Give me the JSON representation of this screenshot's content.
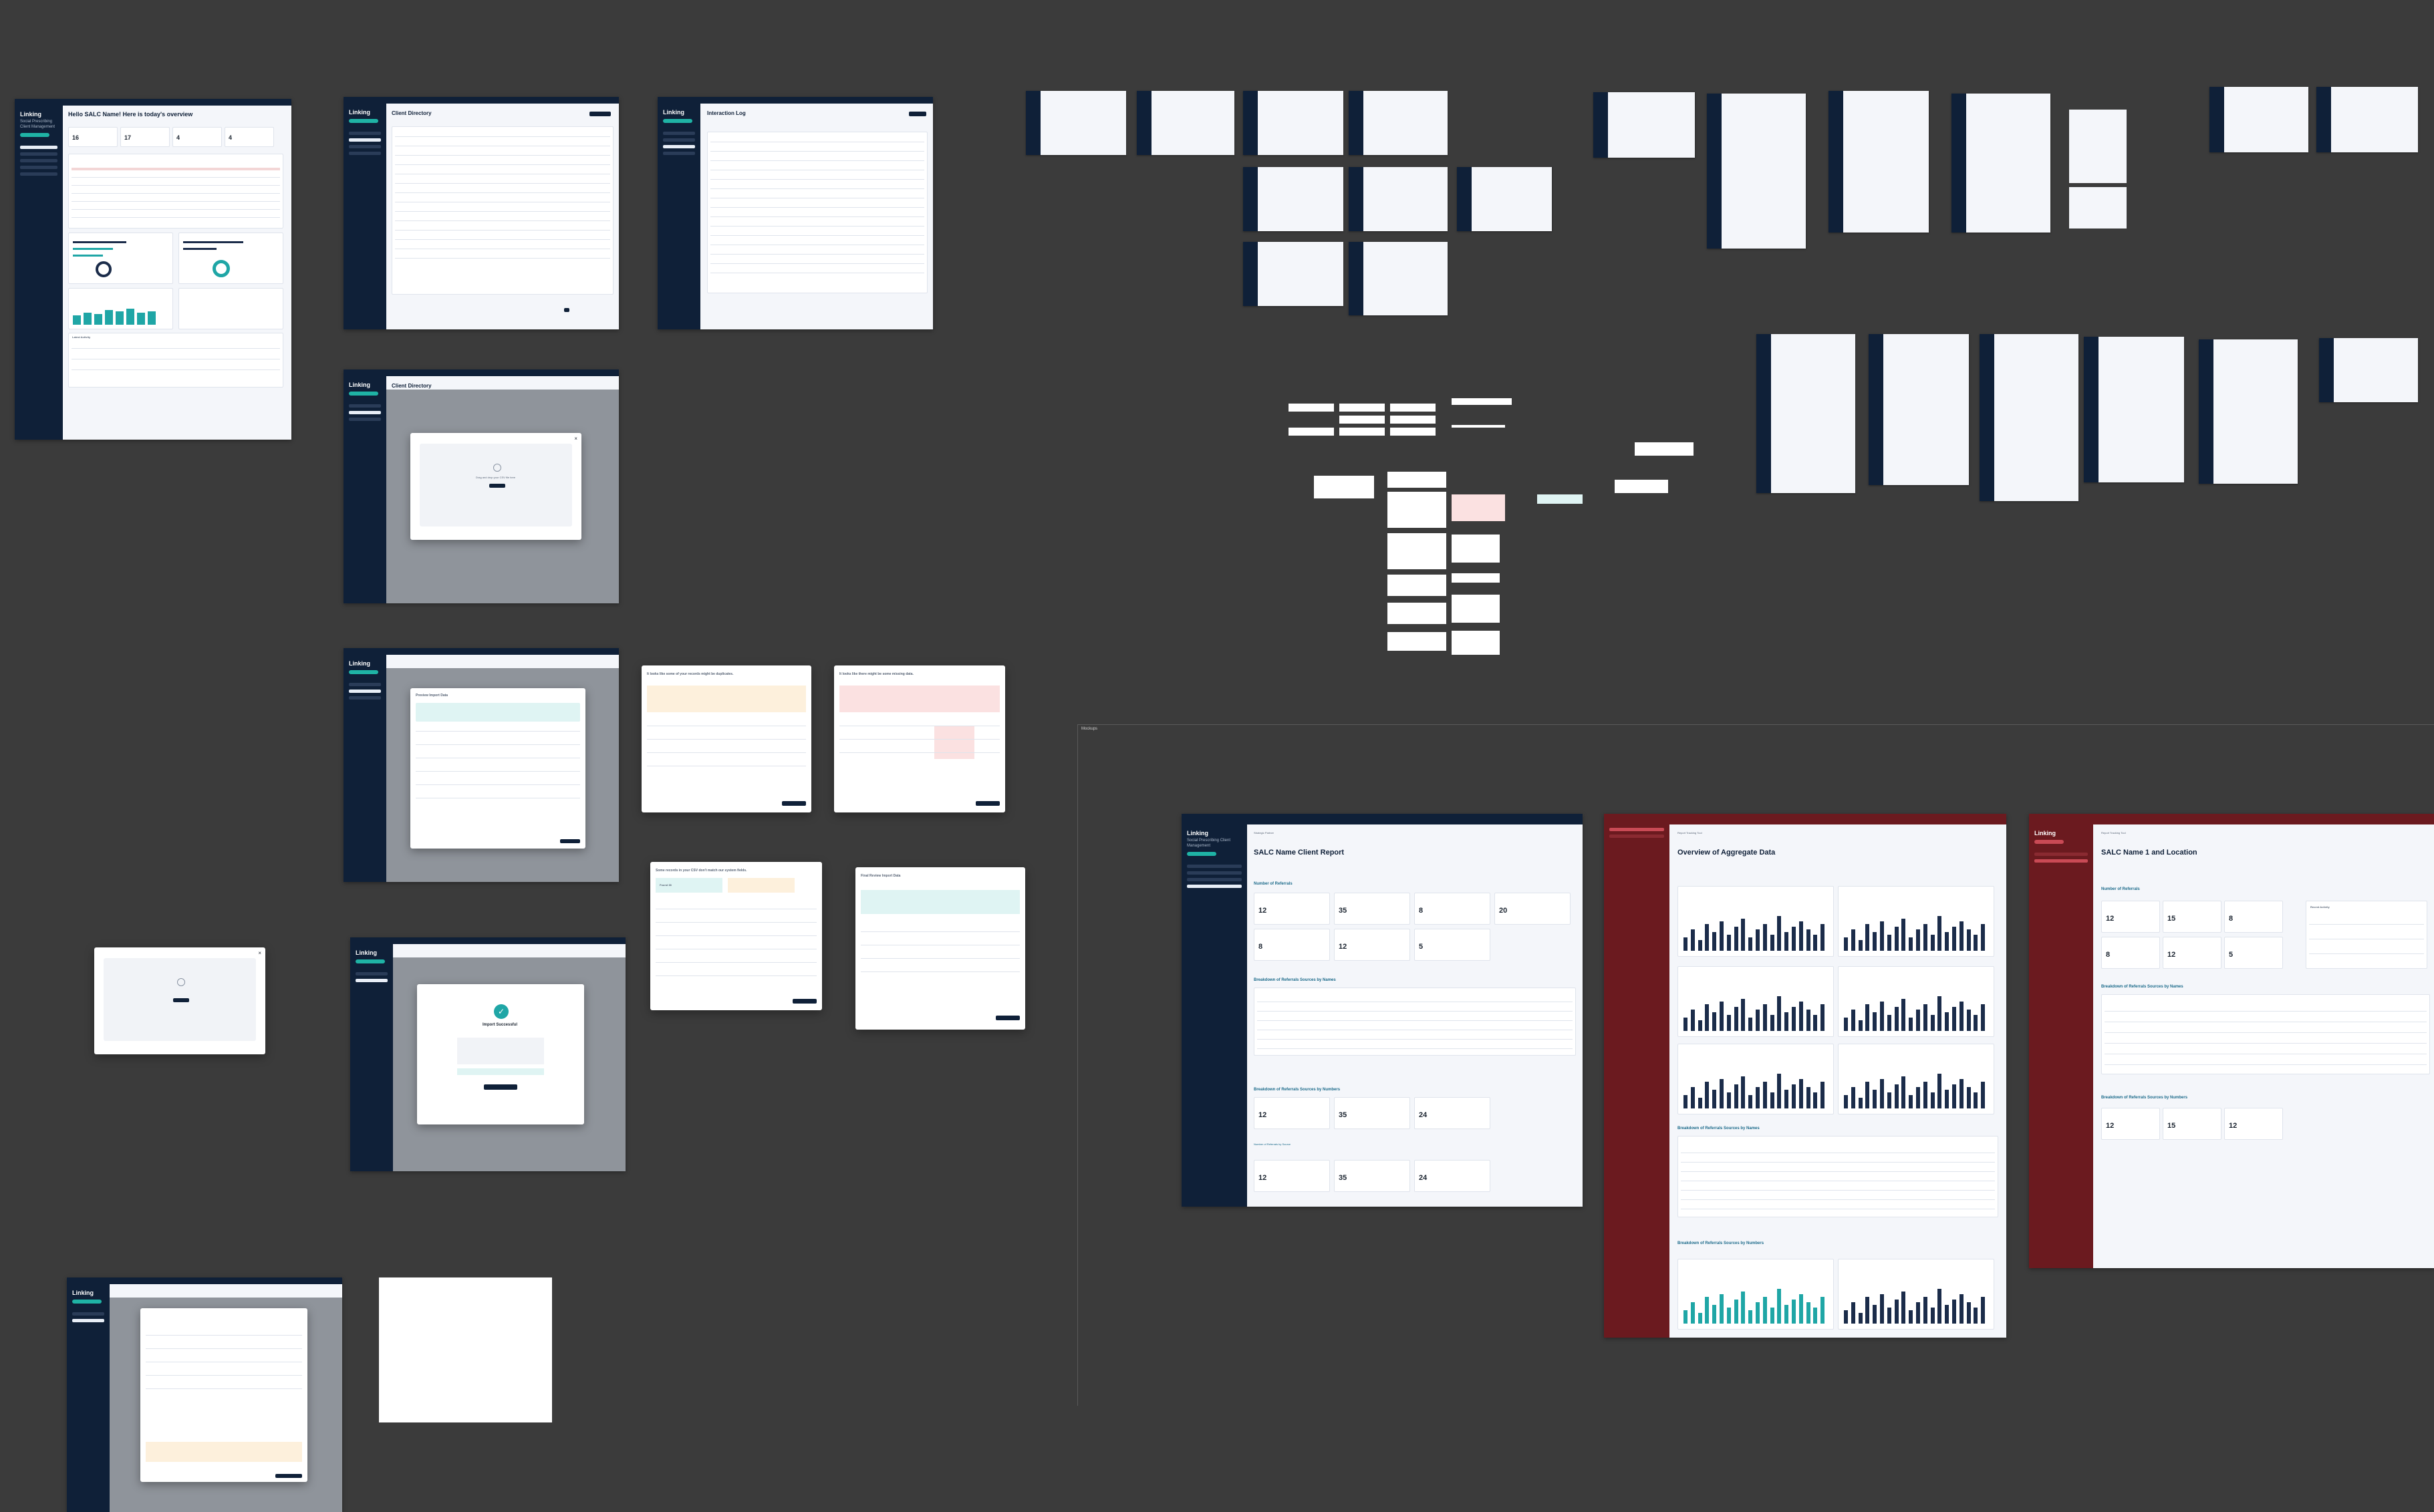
{
  "canvas": {
    "section_label": "Mockups"
  },
  "dashboard": {
    "brand": "Linking",
    "brand_sub": "Social Prescribing Client Management",
    "greeting": "Hello SALC Name! Here is today's overview",
    "stats": [
      "16",
      "17",
      "4",
      "4"
    ],
    "activity_title": "Latest Activity",
    "referrals_title": "Referrals by Source"
  },
  "client_directory": {
    "title": "Client Directory",
    "subtitle": "Manage clients. Add clients.",
    "upload_button": "Upload Data",
    "modal_drop": "Drag and drop your CSV file here",
    "modal_browse": "Browse Files",
    "preview_title": "Preview Import Data",
    "success_title": "Import Successful",
    "success_button": "Return to Directory"
  },
  "interaction_log": {
    "title": "Interaction Log",
    "subtitle": "Manage interactions. Add interactions."
  },
  "warnings": {
    "w1": "It looks like some of your records might be duplicates.",
    "w2": "It looks like there might be some missing data.",
    "w3": "Some records in your CSV don't match our system fields.",
    "w4": "Final Review Import Data",
    "import_count": "Found 38",
    "continue": "Continue"
  },
  "report_salc": {
    "crumb": "Strategic Partner",
    "title": "SALC Name Client Report",
    "section_referrals": "Number of Referrals",
    "stats": [
      "12",
      "35",
      "8",
      "20"
    ],
    "stats2": [
      "8",
      "12",
      "5"
    ],
    "breakdown_names": "Breakdown of Referrals Sources by Names",
    "breakdown_numbers": "Breakdown of Referrals Sources by Numbers",
    "numbers": [
      "12",
      "35",
      "24"
    ],
    "subsection": "Number of Referrals by Source",
    "numbers2": [
      "12",
      "35",
      "24"
    ]
  },
  "report_aggregate": {
    "crumb": "Report Tracking Tool",
    "title": "Overview of Aggregate Data",
    "breakdown_names": "Breakdown of Referrals Sources by Names",
    "breakdown_numbers": "Breakdown of Referrals Sources by Numbers"
  },
  "report_location": {
    "crumb": "Report Tracking Tool",
    "title": "SALC Name 1 and Location",
    "section_referrals": "Number of Referrals",
    "stats": [
      "12",
      "15",
      "8"
    ],
    "stats2": [
      "8",
      "12",
      "5"
    ],
    "recent": "Recent Activity",
    "breakdown_names": "Breakdown of Referrals Sources by Names",
    "breakdown_numbers": "Breakdown of Referrals Sources by Numbers",
    "numbers": [
      "12",
      "15",
      "12"
    ]
  },
  "colors": {
    "navy": "#0f2038",
    "maroon": "#6b1a1f",
    "teal": "#1fa6a6",
    "canvas": "#3b3b3b"
  }
}
